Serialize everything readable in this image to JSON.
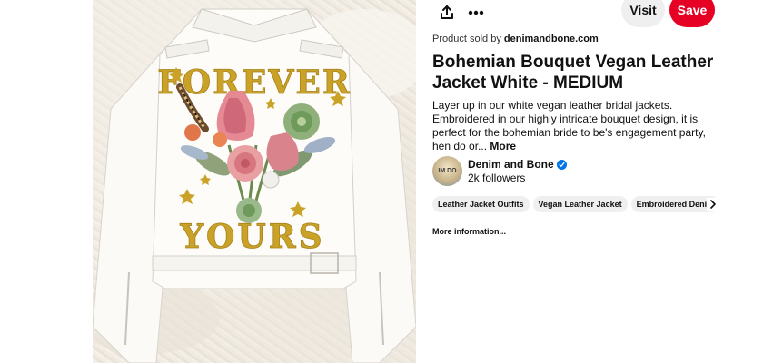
{
  "toolbar": {
    "share_icon": "share-icon",
    "more_icon": "ellipsis-icon",
    "visit_label": "Visit",
    "save_label": "Save"
  },
  "product": {
    "sold_by_prefix": "Product sold by",
    "seller": "denimandbone.com"
  },
  "pin": {
    "title": "Bohemian Bouquet Vegan Leather Jacket White - MEDIUM",
    "description": "Layer up in our white vegan leather bridal jackets. Embroidered in our highly intricate bouquet design, it is perfect for the bohemian bride to be's engagement party, hen do or...",
    "more_label": "More",
    "image_text_top": "FOREVER",
    "image_text_bottom": "YOURS"
  },
  "creator": {
    "name": "Denim and Bone",
    "followers": "2k followers",
    "avatar_text": "IM DO"
  },
  "chips": [
    "Leather Jacket Outfits",
    "Vegan Leather Jacket",
    "Embroidered Denim"
  ],
  "more_info_label": "More information...",
  "colors": {
    "brand_red": "#e60023",
    "pill_gray": "#efefef",
    "verified_blue": "#0074e8",
    "embroidery_gold": "#c9a227"
  }
}
